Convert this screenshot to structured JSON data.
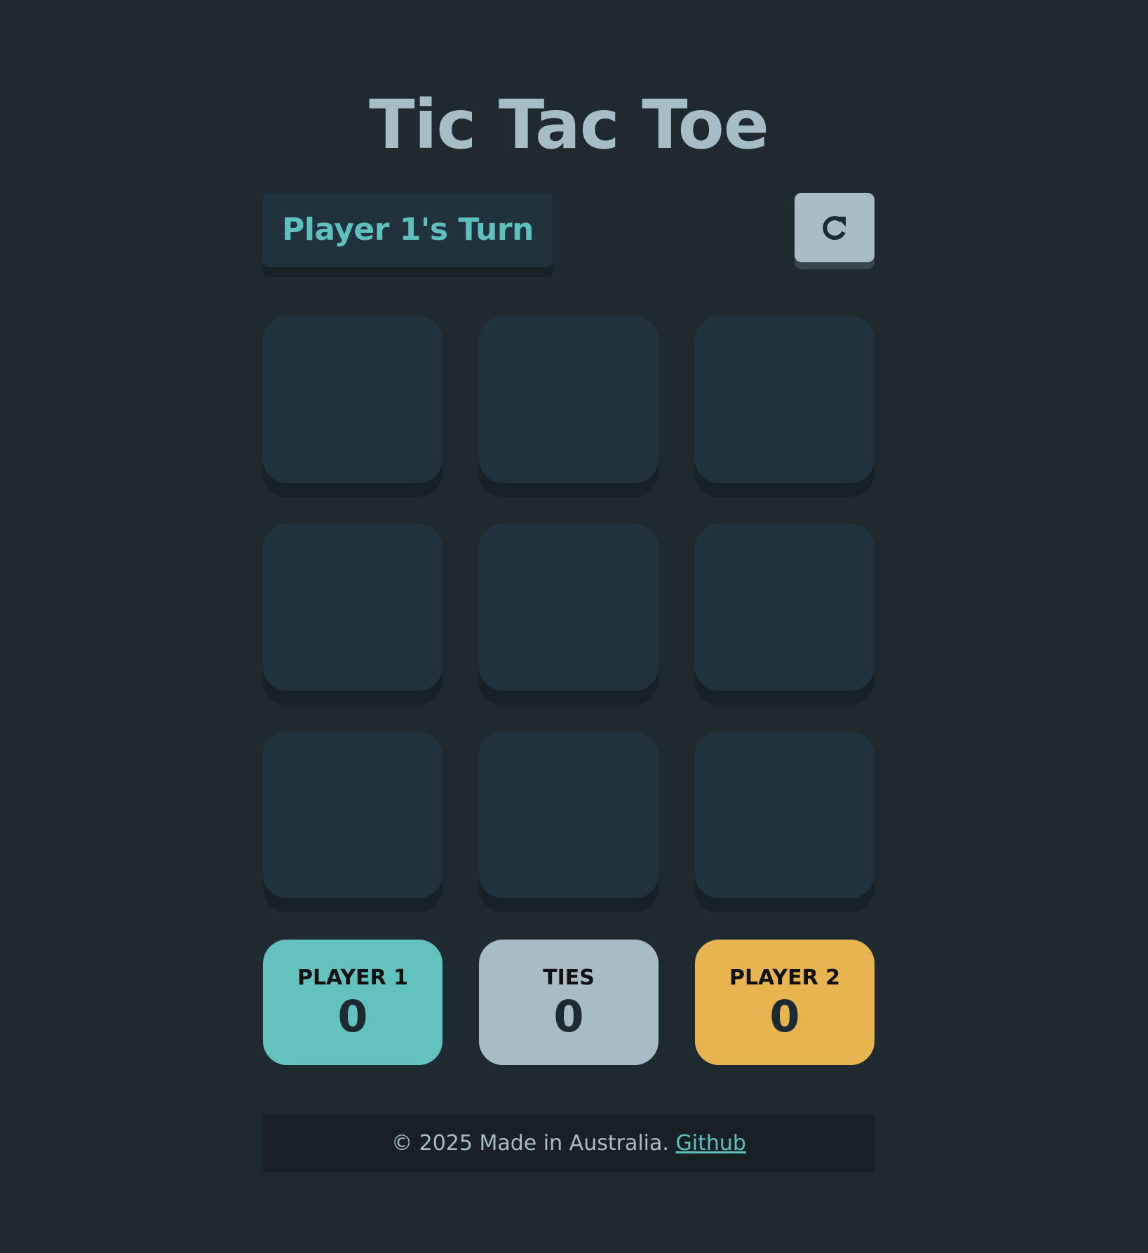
{
  "title": "Tic Tac Toe",
  "status": {
    "turn_text": "Player 1's Turn"
  },
  "restart": {
    "icon": "restart-icon"
  },
  "board": {
    "cells": [
      "",
      "",
      "",
      "",
      "",
      "",
      "",
      "",
      ""
    ]
  },
  "scores": {
    "player1": {
      "label": "PLAYER 1",
      "value": "0",
      "color": "#63c2bd"
    },
    "ties": {
      "label": "TIES",
      "value": "0",
      "color": "#a9bcc6"
    },
    "player2": {
      "label": "PLAYER 2",
      "value": "0",
      "color": "#e8b450"
    }
  },
  "footer": {
    "text": "© 2025 Made in Australia.",
    "link_label": "Github"
  },
  "colors": {
    "background": "#1e2930",
    "cell": "#22323c",
    "accent": "#5fc1bb"
  }
}
